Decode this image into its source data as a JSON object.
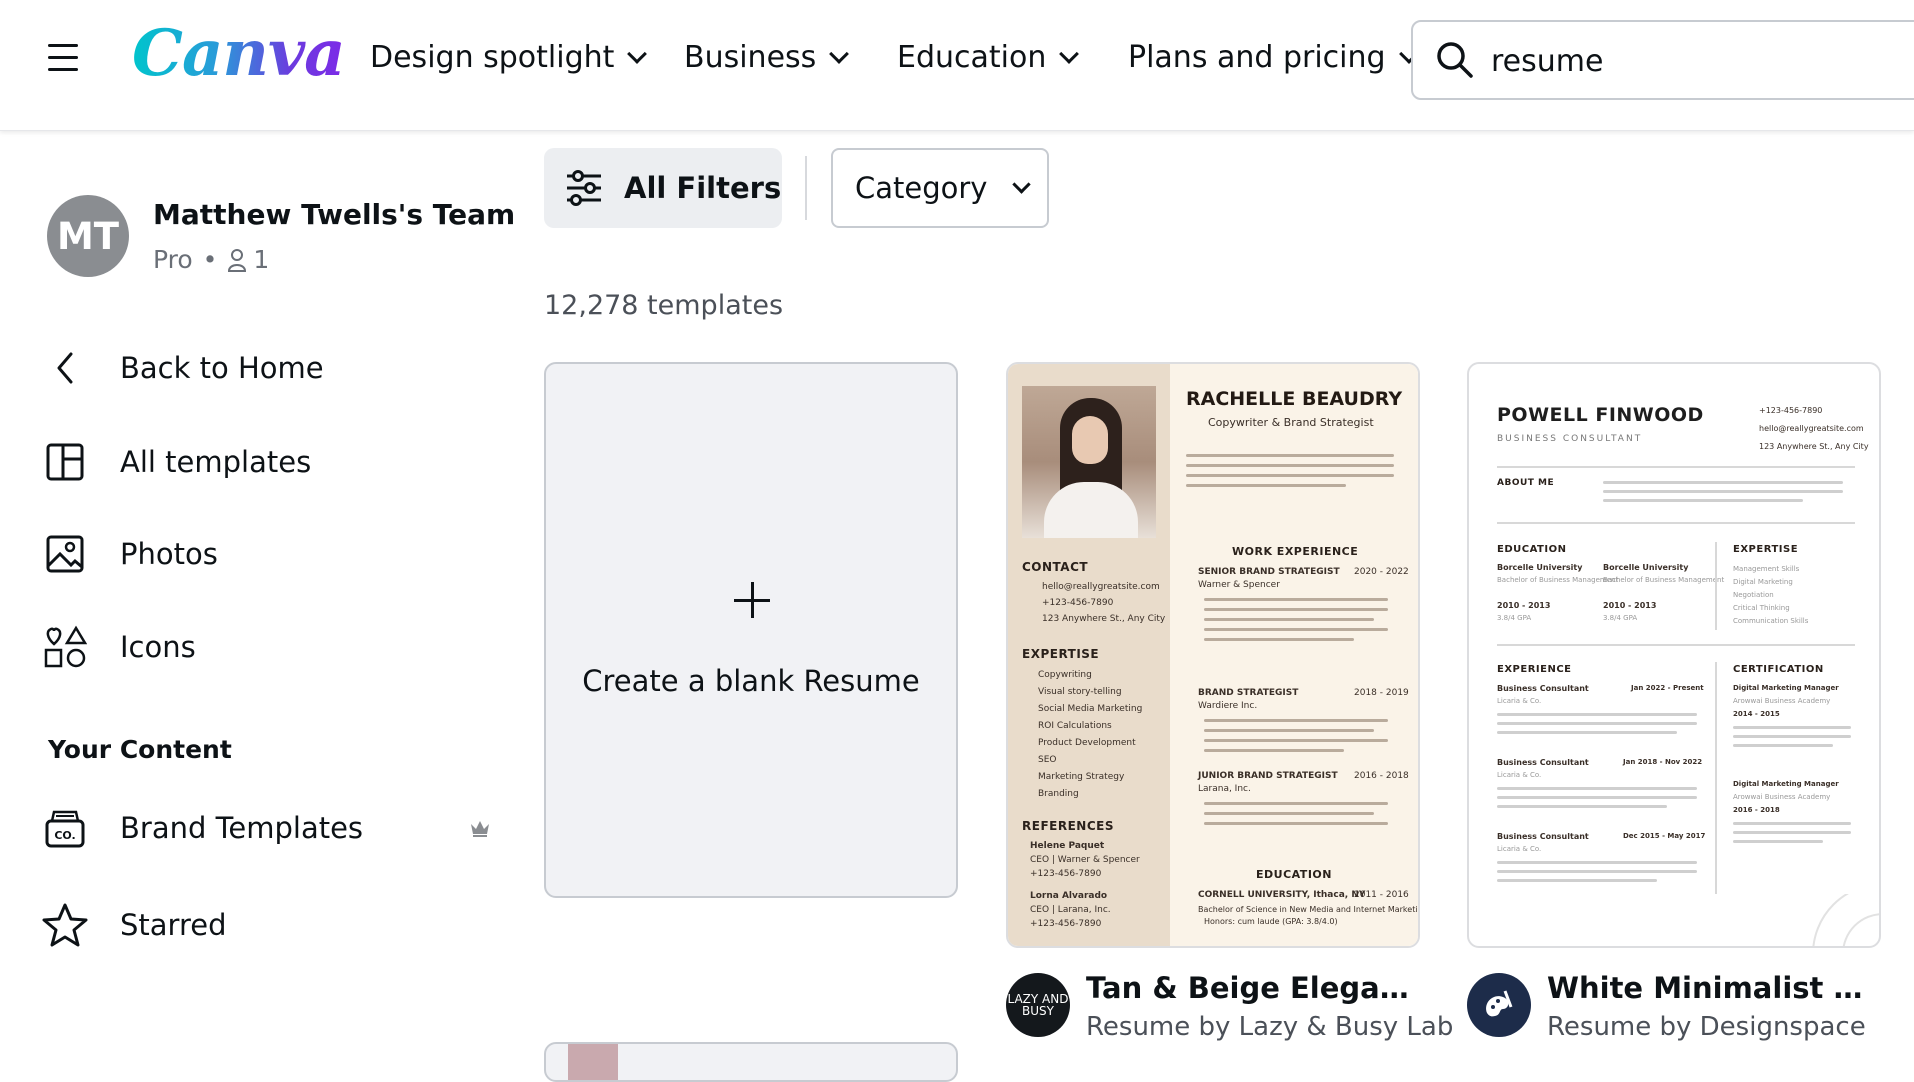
{
  "header": {
    "logo_text": "Canva",
    "nav": [
      {
        "label": "Design spotlight"
      },
      {
        "label": "Business"
      },
      {
        "label": "Education"
      },
      {
        "label": "Plans and pricing"
      }
    ],
    "search": {
      "value": "resume"
    }
  },
  "sidebar": {
    "team": {
      "initials": "MT",
      "name": "Matthew Twells's Team",
      "plan": "Pro",
      "dot": "•",
      "members": "1"
    },
    "nav": [
      {
        "label": "Back to Home",
        "icon": "chevron-left-icon"
      },
      {
        "label": "All templates",
        "icon": "templates-icon"
      },
      {
        "label": "Photos",
        "icon": "photo-icon"
      },
      {
        "label": "Icons",
        "icon": "shapes-icon"
      }
    ],
    "section_title": "Your Content",
    "content": [
      {
        "label": "Brand Templates",
        "icon": "brand-kit-icon",
        "badge": "crown-icon"
      },
      {
        "label": "Starred",
        "icon": "star-icon"
      }
    ]
  },
  "main": {
    "filters_label": "All Filters",
    "category_label": "Category",
    "template_count": "12,278 templates",
    "blank_card_label": "Create a blank Resume",
    "templates": [
      {
        "title": "Tan & Beige Elegant Pr...",
        "subtitle": "Resume by Lazy & Busy Lab",
        "creator_avatar_text": "LAZY AND BUSY",
        "preview": {
          "name": "RACHELLE BEAUDRY",
          "role": "Copywriter & Brand Strategist",
          "contact_h": "CONTACT",
          "email": "hello@reallygreatsite.com",
          "phone": "+123-456-7890",
          "address": "123 Anywhere St., Any City",
          "expertise_h": "EXPERTISE",
          "expertise": [
            "Copywriting",
            "Visual story-telling",
            "Social Media Marketing",
            "ROI Calculations",
            "Product Development",
            "SEO",
            "Marketing Strategy",
            "Branding"
          ],
          "references_h": "REFERENCES",
          "ref1_name": "Helene Paquet",
          "ref1_role": "CEO | Warner & Spencer",
          "ref1_phone": "+123-456-7890",
          "ref2_name": "Lorna Alvarado",
          "ref2_role": "CEO | Larana, Inc.",
          "ref2_phone": "+123-456-7890",
          "work_h": "WORK EXPERIENCE",
          "job1": "SENIOR BRAND STRATEGIST",
          "job1_dates": "2020 - 2022",
          "job1_co": "Warner & Spencer",
          "job2": "BRAND STRATEGIST",
          "job2_dates": "2018 - 2019",
          "job2_co": "Wardiere Inc.",
          "job3": "JUNIOR BRAND STRATEGIST",
          "job3_dates": "2016 - 2018",
          "job3_co": "Larana, Inc.",
          "edu_h": "EDUCATION",
          "edu_school": "CORNELL UNIVERSITY, Ithaca, NY",
          "edu_dates": "2011 - 2016",
          "edu_degree": "Bachelor of Science in New Media and Internet Marketing",
          "edu_honors": "Honors: cum laude (GPA: 3.8/4.0)"
        }
      },
      {
        "title": "White Minimalist Busin...",
        "subtitle": "Resume by Designspace",
        "preview": {
          "name": "POWELL FINWOOD",
          "role": "BUSINESS CONSULTANT",
          "phone": "+123-456-7890",
          "email": "hello@reallygreatsite.com",
          "address": "123 Anywhere St., Any City",
          "about_h": "ABOUT ME",
          "education_h": "EDUCATION",
          "edu1_school": "Borcelle University",
          "edu1_degree": "Bachelor of Business Management",
          "edu1_dates": "2010 - 2013",
          "edu1_gpa": "3.8/4 GPA",
          "edu2_school": "Borcelle University",
          "edu2_degree": "Bachelor of Business Management",
          "edu2_dates": "2010 - 2013",
          "edu2_gpa": "3.8/4 GPA",
          "expertise_h": "EXPERTISE",
          "expertise": [
            "Management Skills",
            "Digital Marketing",
            "Negotiation",
            "Critical Thinking",
            "Communication Skills"
          ],
          "experience_h": "EXPERIENCE",
          "exp1_title": "Business Consultant",
          "exp1_dates": "Jan 2022 - Present",
          "exp1_co": "Licaria & Co.",
          "exp2_title": "Business Consultant",
          "exp2_dates": "Jan 2018 - Nov 2022",
          "exp2_co": "Licaria & Co.",
          "exp3_title": "Business Consultant",
          "exp3_dates": "Dec 2015 - May 2017",
          "exp3_co": "Licaria & Co.",
          "cert_h": "CERTIFICATION",
          "cert1": "Digital Marketing Manager",
          "cert1_org": "Arowwai Business Academy",
          "cert1_dates": "2014 - 2015",
          "cert2": "Digital Marketing Manager",
          "cert2_org": "Arowwai Business Academy",
          "cert2_dates": "2016 - 2018"
        }
      }
    ]
  }
}
